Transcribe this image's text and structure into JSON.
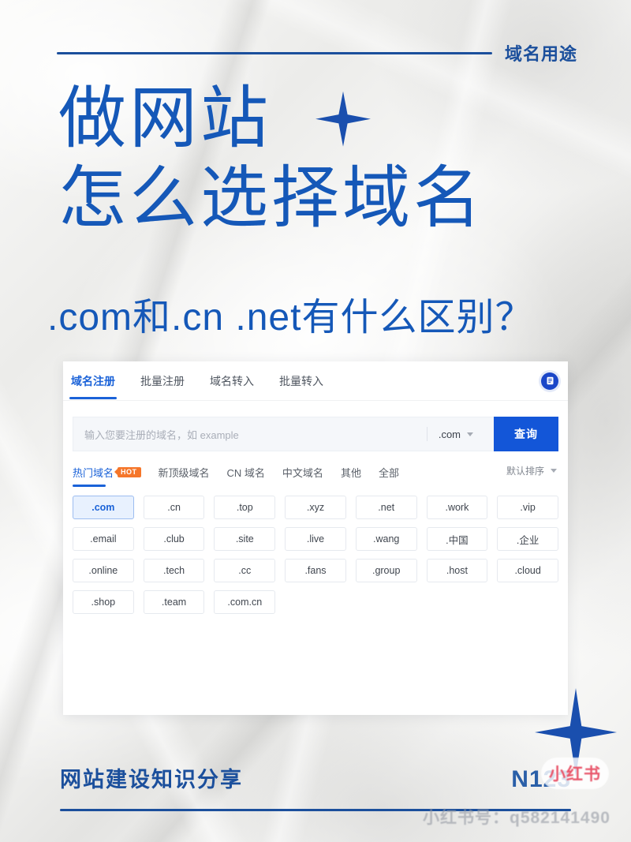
{
  "header": {
    "label": "域名用途"
  },
  "title": {
    "line1": "做网站",
    "line2": "怎么选择域名",
    "subtitle": ".com和.cn .net有什么区别？"
  },
  "panel": {
    "nav_tabs": [
      {
        "label": "域名注册",
        "active": true
      },
      {
        "label": "批量注册",
        "active": false
      },
      {
        "label": "域名转入",
        "active": false
      },
      {
        "label": "批量转入",
        "active": false
      }
    ],
    "doc_icon": "document-icon",
    "search": {
      "placeholder": "输入您要注册的域名，如 example",
      "value": "",
      "suffix": ".com",
      "button_label": "查询"
    },
    "filters": [
      {
        "label": "热门域名",
        "active": true,
        "badge": "HOT"
      },
      {
        "label": "新顶级域名",
        "active": false,
        "badge": ""
      },
      {
        "label": "CN 域名",
        "active": false,
        "badge": ""
      },
      {
        "label": "中文域名",
        "active": false,
        "badge": ""
      },
      {
        "label": "其他",
        "active": false,
        "badge": ""
      },
      {
        "label": "全部",
        "active": false,
        "badge": ""
      }
    ],
    "sort": {
      "label": "默认排序"
    },
    "chips": [
      {
        "label": ".com",
        "selected": true
      },
      {
        "label": ".cn",
        "selected": false
      },
      {
        "label": ".top",
        "selected": false
      },
      {
        "label": ".xyz",
        "selected": false
      },
      {
        "label": ".net",
        "selected": false
      },
      {
        "label": ".work",
        "selected": false
      },
      {
        "label": ".vip",
        "selected": false
      },
      {
        "label": ".email",
        "selected": false
      },
      {
        "label": ".club",
        "selected": false
      },
      {
        "label": ".site",
        "selected": false
      },
      {
        "label": ".live",
        "selected": false
      },
      {
        "label": ".wang",
        "selected": false
      },
      {
        "label": ".中国",
        "selected": false
      },
      {
        "label": ".企业",
        "selected": false
      },
      {
        "label": ".online",
        "selected": false
      },
      {
        "label": ".tech",
        "selected": false
      },
      {
        "label": ".cc",
        "selected": false
      },
      {
        "label": ".fans",
        "selected": false
      },
      {
        "label": ".group",
        "selected": false
      },
      {
        "label": ".host",
        "selected": false
      },
      {
        "label": ".cloud",
        "selected": false
      },
      {
        "label": ".shop",
        "selected": false
      },
      {
        "label": ".team",
        "selected": false
      },
      {
        "label": ".com.cn",
        "selected": false
      }
    ]
  },
  "footer": {
    "left": "网站建设知识分享",
    "right": "N123",
    "badge": "小红书",
    "watermark": "小红书号：q582141490"
  },
  "colors": {
    "brand_blue": "#1558b8",
    "deep_blue": "#1b4f9c",
    "accent_blue": "#1a62d8",
    "button_blue": "#1356d8",
    "hot_orange": "#f5762a",
    "star_blue": "#1a4fae",
    "xhs_red": "#e8566b"
  },
  "icons": {
    "chevron": "chevron-down-icon",
    "star": "sparkle-star-icon"
  }
}
